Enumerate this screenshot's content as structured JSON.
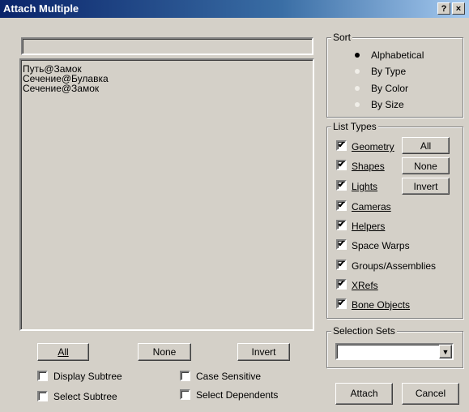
{
  "window": {
    "title": "Attach Multiple",
    "help_label": "?",
    "close_label": "×"
  },
  "filter_input": {
    "value": ""
  },
  "objects": [
    "Путь@Замок",
    "Сечение@Булавка",
    "Сечение@Замок"
  ],
  "list_buttons": {
    "all": "All",
    "none": "None",
    "invert": "Invert"
  },
  "options": {
    "display_subtree": {
      "label": "Display Subtree",
      "checked": false
    },
    "case_sensitive": {
      "label": "Case Sensitive",
      "checked": false
    },
    "select_subtree": {
      "label": "Select Subtree",
      "checked": false
    },
    "select_dependents": {
      "label": "Select Dependents",
      "checked": false
    }
  },
  "sort": {
    "title": "Sort",
    "items": [
      {
        "label": "Alphabetical",
        "selected": true,
        "enabled": true
      },
      {
        "label": "By Type",
        "selected": false,
        "enabled": false
      },
      {
        "label": "By Color",
        "selected": false,
        "enabled": false
      },
      {
        "label": "By Size",
        "selected": false,
        "enabled": false
      }
    ]
  },
  "list_types": {
    "title": "List Types",
    "items": [
      {
        "label": "Geometry",
        "checked": true
      },
      {
        "label": "Shapes",
        "checked": true
      },
      {
        "label": "Lights",
        "checked": true
      },
      {
        "label": "Cameras",
        "checked": true
      },
      {
        "label": "Helpers",
        "checked": true
      },
      {
        "label": "Space Warps",
        "checked": true
      },
      {
        "label": "Groups/Assemblies",
        "checked": true
      },
      {
        "label": "XRefs",
        "checked": true
      },
      {
        "label": "Bone Objects",
        "checked": true
      }
    ],
    "buttons": {
      "all": "All",
      "none": "None",
      "invert": "Invert"
    }
  },
  "selection_sets": {
    "title": "Selection Sets",
    "value": ""
  },
  "actions": {
    "attach": "Attach",
    "cancel": "Cancel"
  },
  "colors": {
    "face": "#d4d0c8",
    "title_start": "#0a246a",
    "title_end": "#a6caf0",
    "disabled_radio": "#f0eee8"
  },
  "icons": {
    "check": "✔",
    "dropdown": "▼",
    "radio_dot": "●"
  }
}
